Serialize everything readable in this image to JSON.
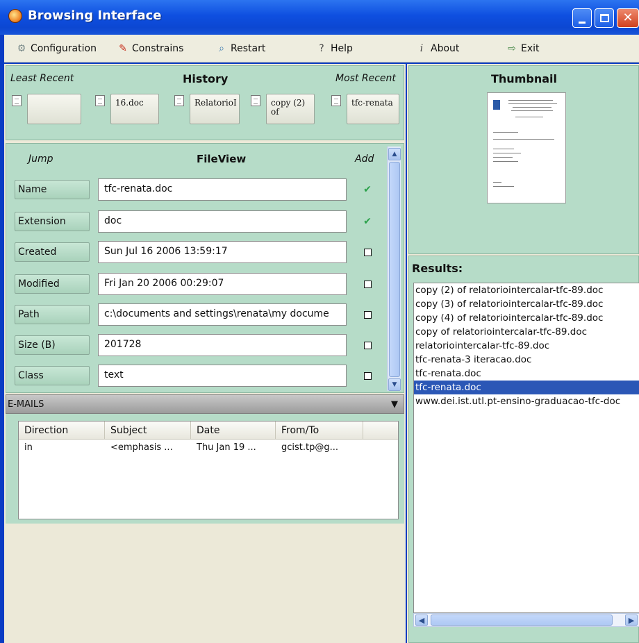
{
  "window": {
    "title": "Browsing Interface"
  },
  "menu": [
    {
      "label": "Configuration",
      "icon": "gears-icon"
    },
    {
      "label": "Constrains",
      "icon": "constraints-icon"
    },
    {
      "label": "Restart",
      "icon": "magnifier-icon"
    },
    {
      "label": "Help",
      "icon": "question-icon"
    },
    {
      "label": "About",
      "icon": "info-icon"
    },
    {
      "label": "Exit",
      "icon": "exit-icon"
    }
  ],
  "history": {
    "least_recent": "Least Recent",
    "title": "History",
    "most_recent": "Most Recent",
    "items": [
      "",
      "16.doc",
      "RelatorioI",
      "copy (2) of",
      "tfc-renata"
    ]
  },
  "fileview": {
    "jump": "Jump",
    "title": "FileView",
    "add": "Add",
    "fields": [
      {
        "name": "Name",
        "value": "tfc-renata.doc",
        "checked": true
      },
      {
        "name": "Extension",
        "value": "doc",
        "checked": true
      },
      {
        "name": "Created",
        "value": "Sun Jul 16 2006 13:59:17",
        "checked": false
      },
      {
        "name": "Modified",
        "value": "Fri Jan 20 2006 00:29:07",
        "checked": false
      },
      {
        "name": "Path",
        "value": "c:\\documents and settings\\renata\\my docume",
        "checked": false
      },
      {
        "name": "Size (B)",
        "value": "201728",
        "checked": false
      },
      {
        "name": "Class",
        "value": "text",
        "checked": false
      }
    ]
  },
  "emails": {
    "title": "E-MAILS",
    "columns": [
      "Direction",
      "Subject",
      "Date",
      "From/To"
    ],
    "rows": [
      [
        "in",
        "<emphasis ...",
        "Thu Jan 19 ...",
        "gcist.tp@g..."
      ]
    ]
  },
  "thumbnail": {
    "title": "Thumbnail"
  },
  "results": {
    "title": "Results:",
    "items": [
      "copy (2) of relatoriointercalar-tfc-89.doc",
      "copy (3) of relatoriointercalar-tfc-89.doc",
      "copy (4) of relatoriointercalar-tfc-89.doc",
      "copy of relatoriointercalar-tfc-89.doc",
      "relatoriointercalar-tfc-89.doc",
      "tfc-renata-3 iteracao.doc",
      "tfc-renata.doc",
      "tfc-renata.doc",
      "www.dei.ist.utl.pt-ensino-graduacao-tfc-doc"
    ],
    "selected_index": 7
  },
  "colors": {
    "panel": "#b6dcc8",
    "selection": "#2b57b6",
    "titlebar": "#0e4fe0"
  }
}
